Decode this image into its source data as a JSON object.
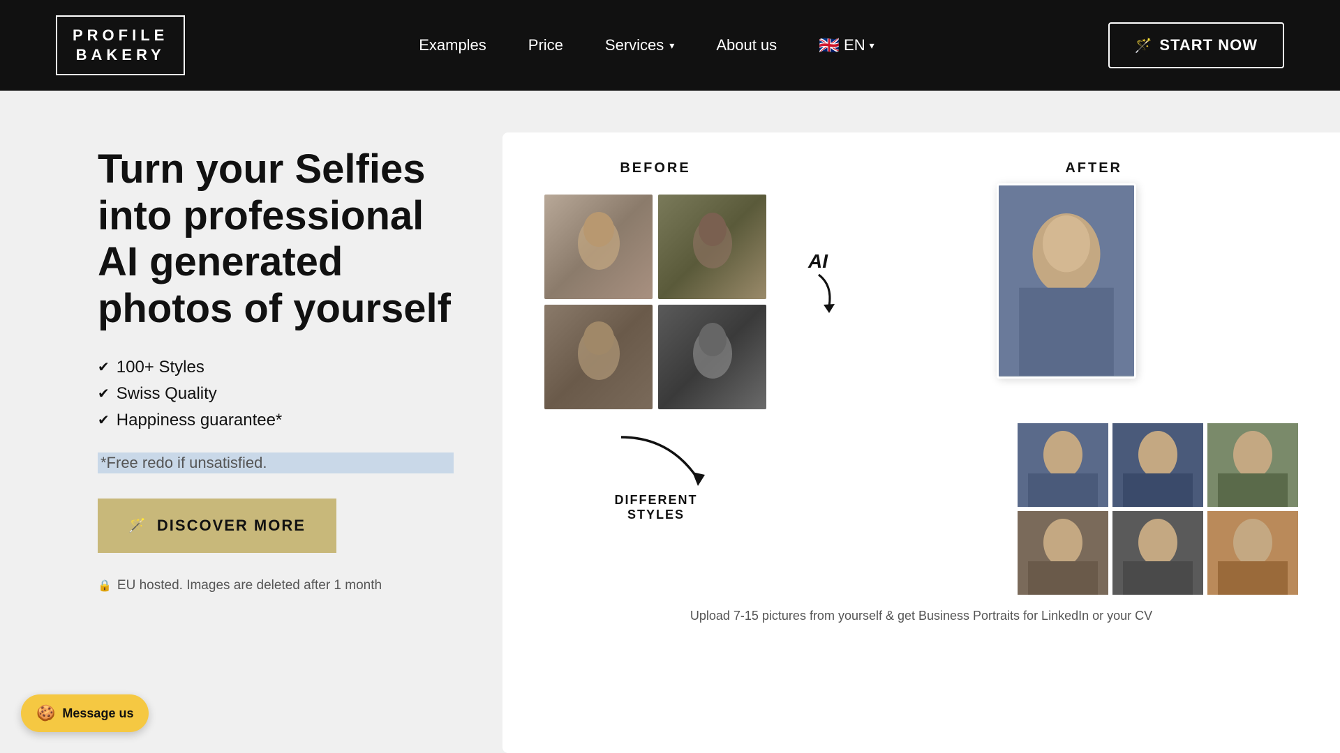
{
  "header": {
    "logo_line1": "PROFILE",
    "logo_line2": "BAKERY",
    "nav": {
      "examples": "Examples",
      "price": "Price",
      "services": "Services",
      "about_us": "About us",
      "lang": "EN"
    },
    "start_now": "START NOW"
  },
  "hero": {
    "title": "Turn your Selfies into professional AI generated photos of yourself",
    "features": [
      "100+ Styles",
      "Swiss Quality",
      "Happiness guarantee*"
    ],
    "free_redo": "*Free redo if unsatisfied.",
    "discover_btn": "DISCOVER MORE",
    "eu_note": "EU hosted. Images are deleted after 1 month"
  },
  "showcase": {
    "before_label": "BEFORE",
    "after_label": "AFTER",
    "ai_label": "AI",
    "different_styles_label": "DIFFERENT\nSTYLES",
    "upload_note": "Upload 7-15 pictures from yourself & get Business Portraits for LinkedIn or your CV"
  },
  "chat": {
    "emoji": "🍪",
    "label": "Message us"
  }
}
